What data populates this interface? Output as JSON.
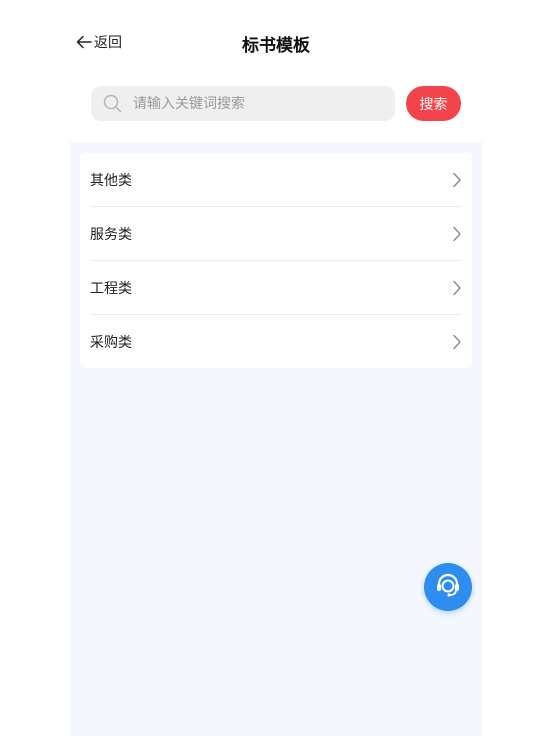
{
  "header": {
    "back_label": "返回",
    "title": "标书模板"
  },
  "search": {
    "placeholder": "请输入关键词搜索",
    "value": "",
    "button_label": "搜索"
  },
  "categories": [
    {
      "label": "其他类"
    },
    {
      "label": "服务类"
    },
    {
      "label": "工程类"
    },
    {
      "label": "采购类"
    }
  ],
  "colors": {
    "accent": "#f3444b",
    "fab": "#2e8ef0",
    "content_background": "#f4f8fe"
  },
  "icons": {
    "back": "arrow-left-icon",
    "search": "search-icon",
    "chevron": "chevron-right-icon",
    "support": "customer-service-icon"
  }
}
